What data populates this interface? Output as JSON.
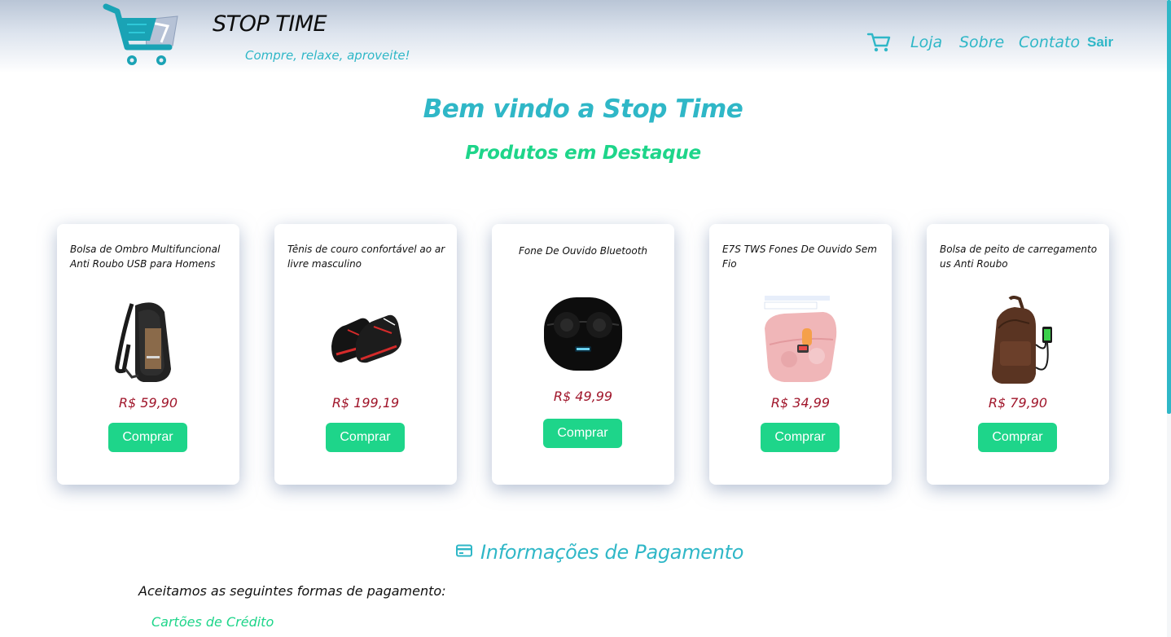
{
  "header": {
    "brand_title": "STOP TIME",
    "brand_tagline": "Compre, relaxe, aproveite!",
    "nav": {
      "loja": "Loja",
      "sobre": "Sobre",
      "contato": "Contato",
      "sair": "Sair"
    }
  },
  "main": {
    "welcome": "Bem vindo a Stop Time",
    "featured_title": "Produtos em Destaque",
    "products": [
      {
        "title": "Bolsa de Ombro Multifuncional Anti Roubo USB para Homens",
        "price": "R$ 59,90",
        "button": "Comprar",
        "image": "sling-bag-image"
      },
      {
        "title": "Tênis de couro confortável ao ar livre masculino",
        "price": "R$ 199,19",
        "button": "Comprar",
        "image": "sneakers-image"
      },
      {
        "title": "Fone De Ouvido Bluetooth",
        "price": "R$ 49,99",
        "button": "Comprar",
        "image": "earbuds-black-image"
      },
      {
        "title": "E7S TWS Fones De Ouvido Sem Fio",
        "price": "R$ 34,99",
        "button": "Comprar",
        "image": "earbuds-pink-image"
      },
      {
        "title": "Bolsa de peito de carregamento us Anti Roubo",
        "price": "R$ 79,90",
        "button": "Comprar",
        "image": "chest-bag-image"
      }
    ]
  },
  "payment": {
    "title": "Informações de Pagamento",
    "intro": "Aceitamos as seguintes formas de pagamento:",
    "methods": [
      "Cartões de Crédito"
    ]
  },
  "colors": {
    "accent": "#2fb7c7",
    "green": "#1ed58a",
    "price": "#a0152a"
  }
}
